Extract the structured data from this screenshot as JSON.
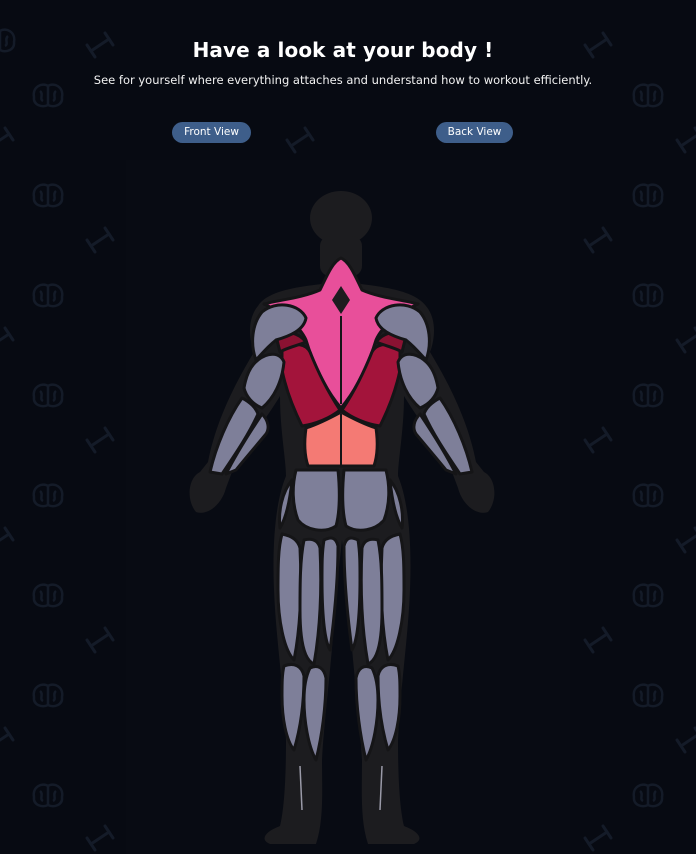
{
  "header": {
    "title": "Have a look at your body !",
    "subtitle": "See for yourself where everything attaches and understand how to workout efficiently."
  },
  "views": {
    "front_label": "Front View",
    "back_label": "Back View",
    "active": "back"
  },
  "figure": {
    "view": "back",
    "highlighted_muscles": [
      {
        "name": "trapezius",
        "color": "#e84f9a"
      },
      {
        "name": "latissimus-dorsi",
        "color": "#a3143b"
      },
      {
        "name": "lower-back",
        "color": "#f47a74"
      }
    ],
    "default_muscle_color": "#7e7f99",
    "silhouette_color": "#1c1c1f"
  },
  "background": {
    "icons": [
      "dumbbell-icon",
      "brain-icon"
    ]
  }
}
